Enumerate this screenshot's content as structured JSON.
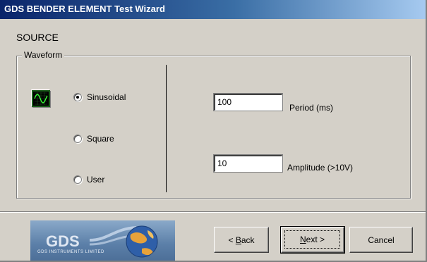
{
  "window": {
    "title": "GDS BENDER ELEMENT Test Wizard"
  },
  "section": {
    "title": "SOURCE"
  },
  "waveform": {
    "group_label": "Waveform",
    "icon": "sine-wave-icon",
    "options": [
      {
        "label": "Sinusoidal",
        "checked": true
      },
      {
        "label": "Square",
        "checked": false
      },
      {
        "label": "User",
        "checked": false
      }
    ],
    "selected": "Sinusoidal"
  },
  "params": {
    "period": {
      "value": "100",
      "label": "Period (ms)"
    },
    "amplitude": {
      "value": "10",
      "label": "Amplitude (>10V)"
    }
  },
  "logo": {
    "text": "GDS",
    "subtext": "GDS INSTRUMENTS LIMITED"
  },
  "buttons": {
    "back": {
      "prefix": "< ",
      "mnemonic": "B",
      "rest": "ack"
    },
    "next": {
      "mnemonic": "N",
      "rest": "ext >"
    },
    "cancel": {
      "label": "Cancel"
    }
  },
  "colors": {
    "titlebar_start": "#0a246a",
    "titlebar_end": "#a6caf0",
    "dialog_bg": "#d4d0c8"
  }
}
